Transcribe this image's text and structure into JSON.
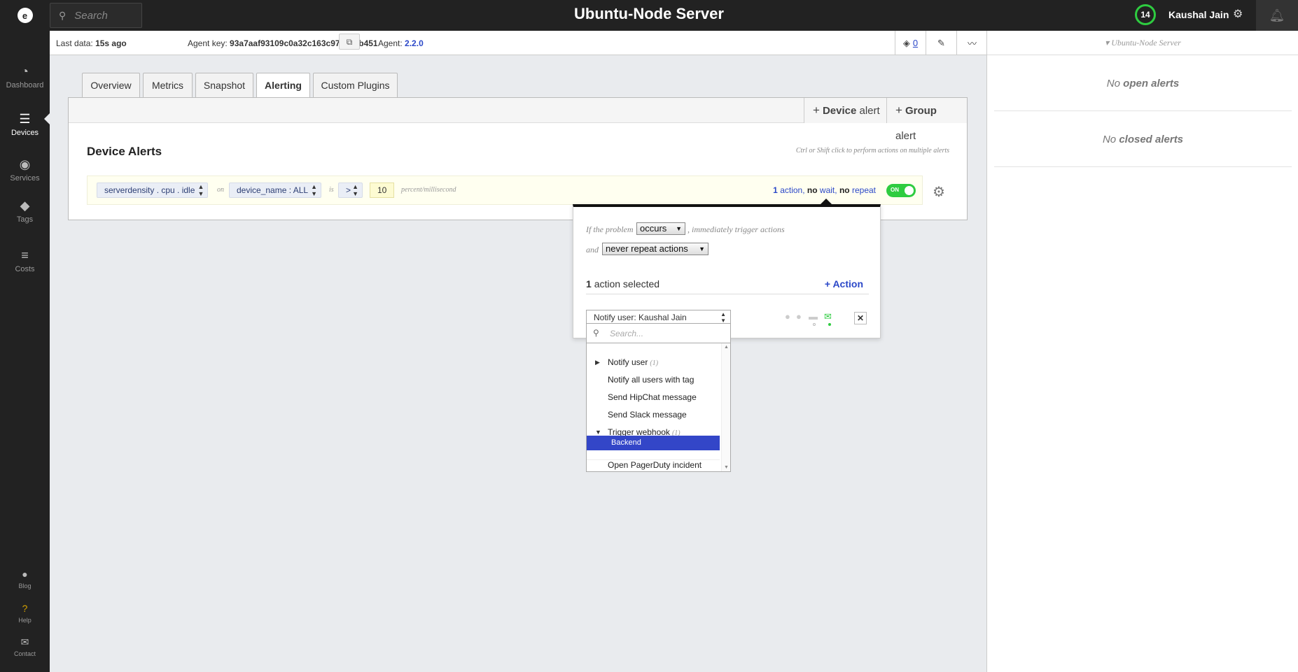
{
  "topbar": {
    "logo_letter": "e",
    "search_placeholder": "Search",
    "title": "Ubuntu-Node Server",
    "count": "14",
    "user": "Kaushal Jain"
  },
  "sidebar": {
    "items": [
      {
        "label": "Dashboard",
        "icon": "dashboard-icon"
      },
      {
        "label": "Devices",
        "icon": "devices-icon"
      },
      {
        "label": "Services",
        "icon": "services-icon"
      },
      {
        "label": "Tags",
        "icon": "tag-icon"
      },
      {
        "label": "Costs",
        "icon": "costs-icon"
      }
    ],
    "bottom": [
      {
        "label": "Blog",
        "icon": "chat-icon"
      },
      {
        "label": "Help",
        "icon": "help-icon"
      },
      {
        "label": "Contact",
        "icon": "mail-icon"
      }
    ]
  },
  "info": {
    "last_data_label": "Last data:",
    "last_data": "15s ago",
    "agent_key_label": "Agent key:",
    "agent_key": "93a7aaf93109c0a32c163c972239b451",
    "agent_label": "Agent:",
    "agent_version": "2.2.0",
    "tag_count": "0"
  },
  "right_panel": {
    "filter": "Ubuntu-Node Server",
    "open_prefix": "No",
    "open_strong": "open alerts",
    "closed_prefix": "No",
    "closed_strong": "closed alerts"
  },
  "tabs": [
    "Overview",
    "Metrics",
    "Snapshot",
    "Alerting",
    "Custom Plugins"
  ],
  "card": {
    "device_alert_strong": "Device",
    "device_alert_rest": "alert",
    "group_alert_strong": "Group",
    "group_alert_rest": "alert",
    "title": "Device Alerts",
    "hint": "Ctrl or Shift click to perform actions on multiple alerts"
  },
  "alert": {
    "metric": "serverdensity . cpu . idle",
    "on": "on",
    "target": "device_name : ALL",
    "is": "is",
    "op": ">",
    "value": "10",
    "unit": "percent/millisecond",
    "sum_count": "1",
    "sum_action": "action,",
    "sum_no1": "no",
    "sum_wait": "wait,",
    "sum_no2": "no",
    "sum_repeat": "repeat",
    "toggle": "ON"
  },
  "popup": {
    "if_text": "If the problem",
    "occurs": "occurs",
    "trigger_text": ", immediately trigger actions",
    "and_text": "and",
    "repeat": "never repeat actions",
    "selected_count": "1",
    "selected_text": "action selected",
    "add_action": "Action",
    "action_value": "Notify user: Kaushal Jain",
    "colors": {
      "active_channel": "#2ecc40",
      "accent": "#2b48c8"
    }
  },
  "dropdown": {
    "search_placeholder": "Search...",
    "items": [
      {
        "label": "Notify user",
        "count": "(1)"
      },
      {
        "label": "Notify all users with tag"
      },
      {
        "label": "Send HipChat message"
      },
      {
        "label": "Send Slack message"
      },
      {
        "label": "Trigger webhook",
        "count": "(1)"
      },
      {
        "label": "Backend"
      },
      {
        "label": "Open PagerDuty incident"
      }
    ]
  }
}
